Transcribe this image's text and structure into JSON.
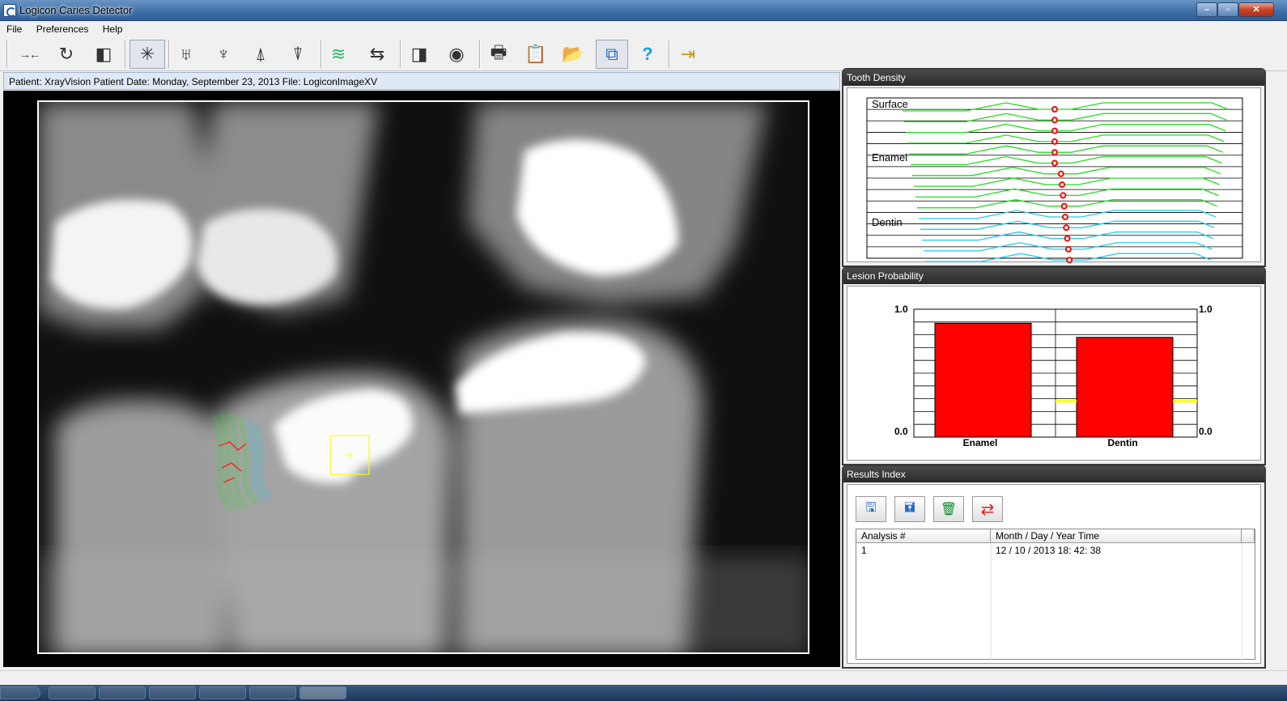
{
  "window": {
    "title": "Logicon Caries Detector",
    "controls": {
      "minimize": "–",
      "maximize": "▫",
      "close": "✕"
    }
  },
  "menu": [
    "File",
    "Preferences",
    "Help"
  ],
  "toolbar": {
    "tools": [
      {
        "name": "measure-tool-icon",
        "glyph": "→←"
      },
      {
        "name": "rotate-hand-icon",
        "glyph": "↻"
      },
      {
        "name": "compare-images-icon",
        "glyph": "◧"
      },
      {
        "name": "analyze-star-icon",
        "glyph": "✳"
      },
      {
        "name": "molar-tooth-icon",
        "glyph": "♅"
      },
      {
        "name": "premolar-tooth-icon",
        "glyph": "♆"
      },
      {
        "name": "canine-tooth-icon",
        "glyph": "⍋"
      },
      {
        "name": "incisor-tooth-icon",
        "glyph": "⍒"
      },
      {
        "name": "density-lines-icon",
        "glyph": "≋"
      },
      {
        "name": "image-flip-icon",
        "glyph": "⇆"
      },
      {
        "name": "contrast-icon",
        "glyph": "◨"
      },
      {
        "name": "zoom-target-icon",
        "glyph": "◉"
      },
      {
        "name": "printer-icon",
        "glyph": "🖶"
      },
      {
        "name": "clipboard-icon",
        "glyph": "📋"
      },
      {
        "name": "open-folder-icon",
        "glyph": "📂"
      },
      {
        "name": "export-icon",
        "glyph": "⧉"
      },
      {
        "name": "help-question-icon",
        "glyph": "?"
      },
      {
        "name": "exit-door-icon",
        "glyph": "⇥"
      }
    ]
  },
  "patient_info": "Patient: XrayVision Patient  Date: Monday, September 23, 2013  File: LogiconImageXV",
  "tooth_density": {
    "title": "Tooth Density",
    "labels": [
      "Surface",
      "Enamel",
      "Dentin"
    ],
    "colors": {
      "enamel": "#22dd22",
      "dentin": "#22ccee",
      "marker": "#ff0000"
    }
  },
  "lesion_probability": {
    "title": "Lesion Probability",
    "chart_data": {
      "type": "bar",
      "categories": [
        "Enamel",
        "Dentin"
      ],
      "values": [
        0.89,
        0.78
      ],
      "threshold": [
        null,
        0.28
      ],
      "ylim": [
        0.0,
        1.0
      ],
      "tick_top": "1.0",
      "tick_bottom": "0.0",
      "bar_color": "#ff0000",
      "threshold_color": "#ffff00"
    }
  },
  "results_index": {
    "title": "Results Index",
    "buttons": [
      {
        "name": "save-result-icon",
        "glyph": "🖫"
      },
      {
        "name": "load-result-icon",
        "glyph": "🖬"
      },
      {
        "name": "delete-trash-icon",
        "glyph": "🗑"
      },
      {
        "name": "compare-arrows-icon",
        "glyph": "⇄"
      }
    ],
    "columns": [
      "Analysis #",
      "Month / Day / Year   Time"
    ],
    "rows": [
      {
        "analysis": "1",
        "datetime": "12 / 10 / 2013   18: 42: 38"
      }
    ]
  }
}
